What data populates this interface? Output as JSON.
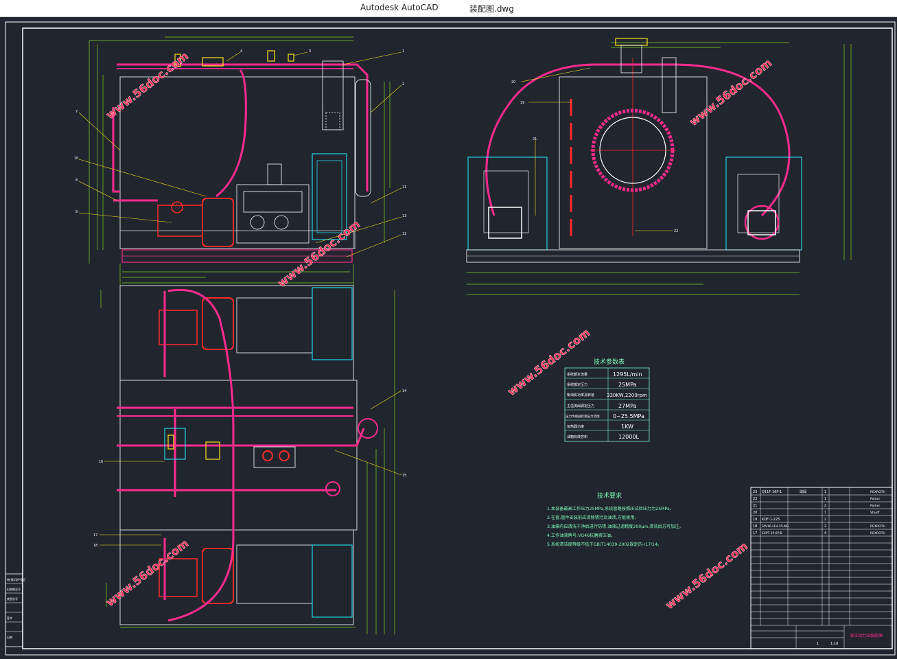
{
  "window": {
    "app_name": "Autodesk AutoCAD",
    "file_name": "装配图.dwg"
  },
  "colors": {
    "background": "#21252e",
    "frame": "#ffffff",
    "line_green": "#7fd41f",
    "pipe_magenta": "#ff2b8f",
    "equipment_red": "#ff2a2a",
    "cyan": "#1fd6e6",
    "yellow": "#ffe51c",
    "watermark": "#ff2a55"
  },
  "watermark": {
    "text": "www.56doc.com"
  },
  "tech_params": {
    "title": "技术参数表",
    "rows": [
      {
        "label": "系统额定流量",
        "value": "1295L/min"
      },
      {
        "label": "系统额定压力",
        "value": "25MPa"
      },
      {
        "label": "柴油机功率及转速",
        "value": "330KW,2200rpm"
      },
      {
        "label": "主溢流阀调定压力",
        "value": "27MPa"
      },
      {
        "label": "压力传感器检测压力范围",
        "value": "0~25.5MPa"
      },
      {
        "label": "加热器功率",
        "value": "1KW"
      },
      {
        "label": "油箱有效容积",
        "value": "12000L"
      }
    ]
  },
  "tech_requirements": {
    "title": "技术要求",
    "items": [
      "1.本装备最高工作压力25MPa,系统管路按照压试验压力为25MPa。",
      "2.在管,管件安装前应清除锈污及油渍,方能使用。",
      "3.油箱内应清洗干净后进行防锈,油液过滤精度200μm,清洗后方可加注。",
      "4.工作油液牌号:VG46抗磨液压油。",
      "5.系统清洁度等级不低于GB/T14039-2002规定的-/17/14。"
    ]
  },
  "title_block": {
    "drawing_name": "液压动力站装配图",
    "scale": "1:10",
    "sheet": "1",
    "bom_top": [
      {
        "no": "23",
        "code": "Q11F-16P-1",
        "name": "球阀",
        "qty": "1",
        "material": "",
        "remark": "REXROTH"
      },
      {
        "no": "22",
        "code": "",
        "name": "",
        "qty": "1",
        "material": "",
        "remark": "Parker"
      },
      {
        "no": "21",
        "code": "",
        "name": "",
        "qty": "2",
        "material": "",
        "remark": "Parker"
      },
      {
        "no": "20",
        "code": "",
        "name": "",
        "qty": "1",
        "material": "",
        "remark": "Stauff"
      },
      {
        "no": "19",
        "code": "KDF-1-225",
        "name": "",
        "qty": "2",
        "material": "",
        "remark": ""
      },
      {
        "no": "18",
        "code": "FAV16-LE4.25-NG",
        "name": "",
        "qty": "2",
        "material": "",
        "remark": "REXROTH"
      },
      {
        "no": "17",
        "code": "EXPT-1P-6P-B",
        "name": "",
        "qty": "4",
        "material": "",
        "remark": "REXROTH"
      }
    ]
  },
  "left_strip": {
    "labels": [
      "借(通)用件登记",
      "旧底图总号",
      "底图总号",
      "签字",
      "日期"
    ]
  }
}
